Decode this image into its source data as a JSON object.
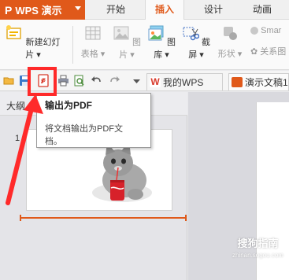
{
  "app": {
    "title": "WPS 演示",
    "logo": "P"
  },
  "menu_tabs": [
    "开始",
    "插入",
    "设计",
    "动画"
  ],
  "active_tab": "插入",
  "ribbon": {
    "new_slide": "新建幻灯片",
    "table": "表格",
    "image": "图片",
    "gallery": "图库",
    "screenshot": "截屏",
    "shape": "形状",
    "smart": "Smar",
    "relation": "关系图"
  },
  "doc_tabs": {
    "wps": "我的WPS",
    "file": "演示文稿1"
  },
  "panel": {
    "outline_tab": "大纲",
    "slide_number": "1"
  },
  "tooltip": {
    "title": "输出为PDF",
    "description_line1": "将文档输出为PDF文",
    "description_line2": "档。"
  },
  "watermark": {
    "brand": "搜狗指南",
    "url": "zhinan.sogou.com"
  },
  "colors": {
    "accent": "#e0591a",
    "highlight": "#ff2a2a",
    "wps_red": "#d83a2b"
  }
}
